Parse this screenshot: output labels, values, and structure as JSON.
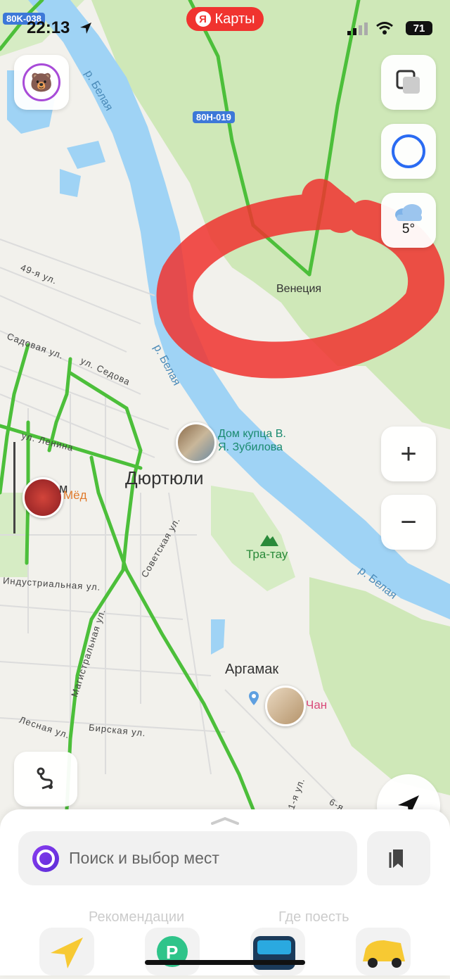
{
  "status_bar": {
    "time": "22:13",
    "battery": "71",
    "app_badge": "Карты",
    "ya_letter": "Я"
  },
  "map": {
    "road_badges": [
      "80K-038",
      "80H-019"
    ],
    "river_labels": [
      "р. Белая",
      "р. Белая",
      "р. Белая"
    ],
    "places": {
      "city": "Дюртюли",
      "village1": "Венеция",
      "village2": "Аргамак"
    },
    "streets": [
      "49-я ул.",
      "Садовая ул.",
      "ул. Седова",
      "ул. Ленина",
      "Советская ул.",
      "Индустриальная ул.",
      "Магистральная ул.",
      "Лесная ул.",
      "Бирская ул.",
      "1-я ул.",
      "6-я"
    ],
    "pois": [
      {
        "name": "Дом купца В. Я. Зубилова",
        "line1": "Дом купца В.",
        "line2": "Я. Зубилова",
        "color": "#1a8a6f"
      },
      {
        "name": "Тра-тау",
        "color": "#2a8a3a"
      },
      {
        "name": "Мёд",
        "color": "#e07a2c"
      },
      {
        "name": "Чан",
        "color": "#d94b7a"
      }
    ],
    "partial_label": "м"
  },
  "controls": {
    "weather_temp": "5°",
    "zoom_in": "+",
    "zoom_out": "−"
  },
  "bottom_sheet": {
    "search_placeholder": "Поиск и выбор мест",
    "ghost_tabs": [
      "Рекомендации",
      "Где поесть"
    ]
  },
  "colors": {
    "accent_red": "#f0332f",
    "water": "#9fd3f5",
    "forest": "#cfe8b8",
    "traffic_green": "#4cbf3a"
  }
}
